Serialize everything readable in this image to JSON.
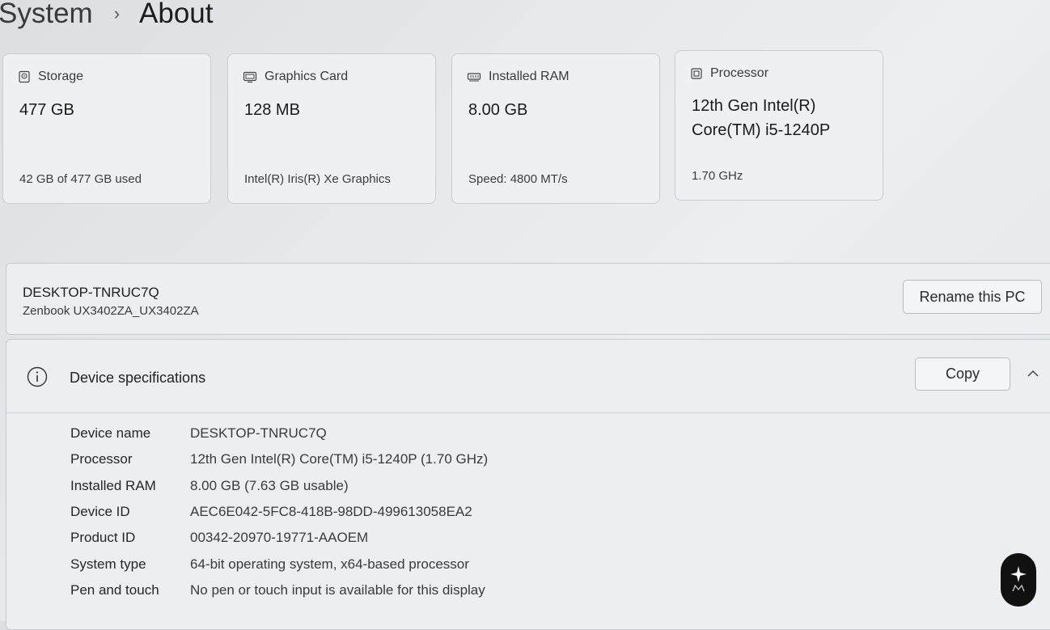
{
  "breadcrumb": {
    "parent": "System",
    "current": "About"
  },
  "cards": {
    "storage": {
      "label": "Storage",
      "value": "477 GB",
      "detail": "42 GB of 477 GB used"
    },
    "graphics": {
      "label": "Graphics Card",
      "value": "128 MB",
      "detail": "Intel(R) Iris(R) Xe Graphics"
    },
    "ram": {
      "label": "Installed RAM",
      "value": "8.00 GB",
      "detail": "Speed: 4800 MT/s"
    },
    "processor": {
      "label": "Processor",
      "value_line1": "12th Gen Intel(R)",
      "value_line2": "Core(TM) i5-1240P",
      "detail": "1.70 GHz"
    }
  },
  "pc": {
    "name": "DESKTOP-TNRUC7Q",
    "model": "Zenbook UX3402ZA_UX3402ZA",
    "rename_label": "Rename this PC"
  },
  "specs": {
    "title": "Device specifications",
    "copy_label": "Copy",
    "rows": [
      {
        "key": "Device name",
        "value": "DESKTOP-TNRUC7Q"
      },
      {
        "key": "Processor",
        "value": "12th Gen Intel(R) Core(TM) i5-1240P (1.70 GHz)"
      },
      {
        "key": "Installed RAM",
        "value": "8.00 GB (7.63 GB usable)"
      },
      {
        "key": "Device ID",
        "value": "AEC6E042-5FC8-418B-98DD-499613058EA2"
      },
      {
        "key": "Product ID",
        "value": "00342-20970-19771-AAOEM"
      },
      {
        "key": "System type",
        "value": "64-bit operating system, x64-based processor"
      },
      {
        "key": "Pen and touch",
        "value": "No pen or touch input is available for this display"
      }
    ]
  },
  "icons": {
    "storage": "storage-icon",
    "graphics": "gpu-icon",
    "ram": "ram-icon",
    "processor": "cpu-icon",
    "info": "info-icon",
    "collapse": "chevron-up-icon"
  }
}
